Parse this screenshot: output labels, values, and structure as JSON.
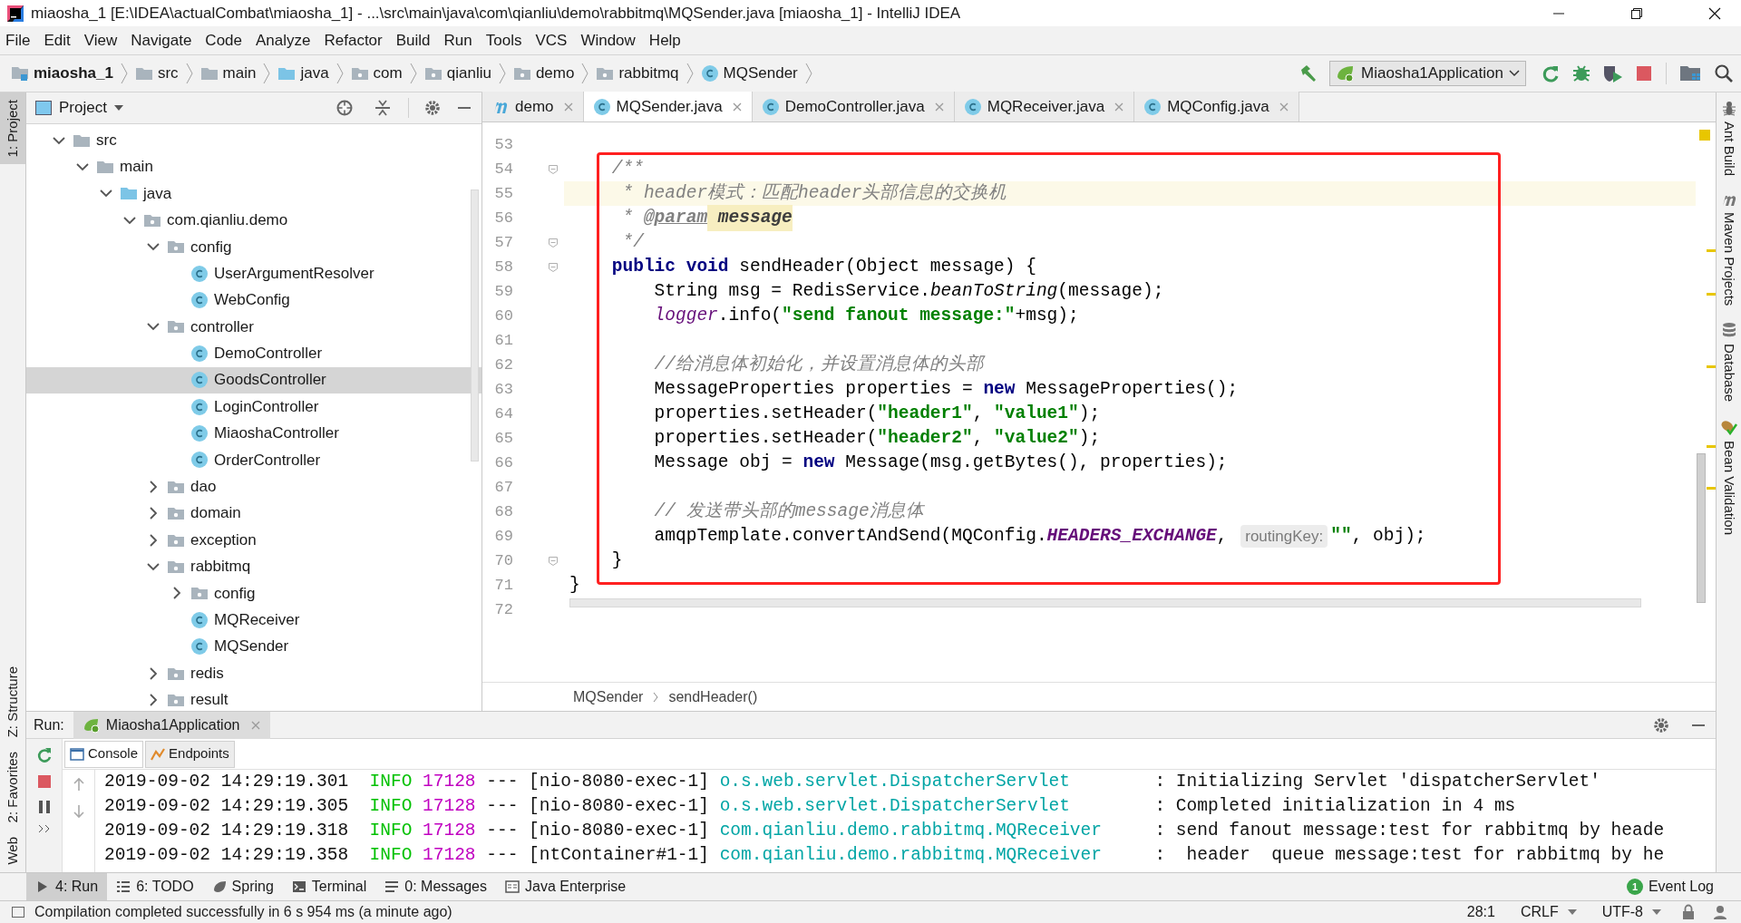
{
  "window": {
    "title": "miaosha_1 [E:\\IDEA\\actualCombat\\miaosha_1] - ...\\src\\main\\java\\com\\qianliu\\demo\\rabbitmq\\MQSender.java [miaosha_1] - IntelliJ IDEA"
  },
  "menu": [
    "File",
    "Edit",
    "View",
    "Navigate",
    "Code",
    "Analyze",
    "Refactor",
    "Build",
    "Run",
    "Tools",
    "VCS",
    "Window",
    "Help"
  ],
  "breadcrumbs": [
    {
      "label": "miaosha_1",
      "kind": "module"
    },
    {
      "label": "src",
      "kind": "folder"
    },
    {
      "label": "main",
      "kind": "folder"
    },
    {
      "label": "java",
      "kind": "source"
    },
    {
      "label": "com",
      "kind": "package"
    },
    {
      "label": "qianliu",
      "kind": "package"
    },
    {
      "label": "demo",
      "kind": "package"
    },
    {
      "label": "rabbitmq",
      "kind": "package"
    },
    {
      "label": "MQSender",
      "kind": "class"
    }
  ],
  "run_configuration": "Miaosha1Application",
  "left_strip": [
    {
      "label": "1: Project",
      "selected": true
    },
    {
      "label": "Z: Structure",
      "selected": false
    },
    {
      "label": "2: Favorites",
      "selected": false
    },
    {
      "label": "Web",
      "selected": false
    }
  ],
  "right_strip": [
    "Ant Build",
    "Maven Projects",
    "Database",
    "Bean Validation"
  ],
  "project": {
    "title": "Project",
    "tree": [
      {
        "label": "src",
        "kind": "folder",
        "expanded": true,
        "selected": false,
        "children": [
          {
            "label": "main",
            "kind": "folder",
            "expanded": true,
            "selected": false,
            "children": [
              {
                "label": "java",
                "kind": "source",
                "expanded": true,
                "selected": false,
                "children": [
                  {
                    "label": "com.qianliu.demo",
                    "kind": "package",
                    "expanded": true,
                    "selected": false,
                    "children": [
                      {
                        "label": "config",
                        "kind": "package",
                        "expanded": true,
                        "selected": false,
                        "children": [
                          {
                            "label": "UserArgumentResolver",
                            "kind": "class",
                            "selected": false
                          },
                          {
                            "label": "WebConfig",
                            "kind": "class",
                            "selected": false
                          }
                        ]
                      },
                      {
                        "label": "controller",
                        "kind": "package",
                        "expanded": true,
                        "selected": false,
                        "children": [
                          {
                            "label": "DemoController",
                            "kind": "class",
                            "selected": false
                          },
                          {
                            "label": "GoodsController",
                            "kind": "class",
                            "selected": true
                          },
                          {
                            "label": "LoginController",
                            "kind": "class",
                            "selected": false
                          },
                          {
                            "label": "MiaoshaController",
                            "kind": "class",
                            "selected": false
                          },
                          {
                            "label": "OrderController",
                            "kind": "class",
                            "selected": false
                          }
                        ]
                      },
                      {
                        "label": "dao",
                        "kind": "package",
                        "expanded": false,
                        "selected": false
                      },
                      {
                        "label": "domain",
                        "kind": "package",
                        "expanded": false,
                        "selected": false
                      },
                      {
                        "label": "exception",
                        "kind": "package",
                        "expanded": false,
                        "selected": false
                      },
                      {
                        "label": "rabbitmq",
                        "kind": "package",
                        "expanded": true,
                        "selected": false,
                        "children": [
                          {
                            "label": "config",
                            "kind": "package",
                            "expanded": false,
                            "selected": false
                          },
                          {
                            "label": "MQReceiver",
                            "kind": "class",
                            "selected": false
                          },
                          {
                            "label": "MQSender",
                            "kind": "class",
                            "selected": false
                          }
                        ]
                      },
                      {
                        "label": "redis",
                        "kind": "package",
                        "expanded": false,
                        "selected": false
                      },
                      {
                        "label": "result",
                        "kind": "package",
                        "expanded": false,
                        "selected": false
                      }
                    ]
                  }
                ]
              }
            ]
          }
        ]
      }
    ]
  },
  "editor": {
    "tabs": [
      {
        "label": "demo",
        "kind": "maven",
        "selected": false
      },
      {
        "label": "MQSender.java",
        "kind": "class",
        "selected": true
      },
      {
        "label": "DemoController.java",
        "kind": "class",
        "selected": false
      },
      {
        "label": "MQReceiver.java",
        "kind": "class",
        "selected": false
      },
      {
        "label": "MQConfig.java",
        "kind": "class",
        "selected": false
      }
    ],
    "lines": [
      {
        "number": "53",
        "current": false,
        "fold": false
      },
      {
        "number": "54",
        "current": false,
        "fold": true,
        "tokens": [
          {
            "text": "    /**",
            "kind": "doc"
          }
        ]
      },
      {
        "number": "55",
        "current": true,
        "fold": false,
        "tokens": [
          {
            "text": "     * header模式：匹配header头部信息的交换机",
            "kind": "doc"
          }
        ]
      },
      {
        "number": "56",
        "current": false,
        "fold": false,
        "tokens": [
          {
            "text": "     * ",
            "kind": "doc"
          },
          {
            "text": "@param",
            "kind": "doctag"
          },
          {
            "text": " message",
            "kind": "docparam"
          }
        ]
      },
      {
        "number": "57",
        "current": false,
        "fold": true,
        "tokens": [
          {
            "text": "     */",
            "kind": "doc"
          }
        ]
      },
      {
        "number": "58",
        "current": false,
        "fold": true,
        "tokens": [
          {
            "text": "    public void",
            "kind": "keyword"
          },
          {
            "text": " sendHeader(Object message) {",
            "kind": "plain"
          }
        ]
      },
      {
        "number": "59",
        "current": false,
        "fold": false,
        "tokens": [
          {
            "text": "        String msg = RedisService.",
            "kind": "plain"
          },
          {
            "text": "beanToString",
            "kind": "static"
          },
          {
            "text": "(message);",
            "kind": "plain"
          }
        ]
      },
      {
        "number": "60",
        "current": false,
        "fold": false,
        "tokens": [
          {
            "text": "        logger",
            "kind": "field"
          },
          {
            "text": ".info(",
            "kind": "plain"
          },
          {
            "text": "\"send fanout message:\"",
            "kind": "string"
          },
          {
            "text": "+msg);",
            "kind": "plain"
          }
        ]
      },
      {
        "number": "61",
        "current": false,
        "fold": false
      },
      {
        "number": "62",
        "current": false,
        "fold": false,
        "tokens": [
          {
            "text": "        //给消息体初始化，并设置消息体的头部",
            "kind": "comment"
          }
        ]
      },
      {
        "number": "63",
        "current": false,
        "fold": false,
        "tokens": [
          {
            "text": "        MessageProperties properties = ",
            "kind": "plain"
          },
          {
            "text": "new",
            "kind": "keyword"
          },
          {
            "text": " MessageProperties();",
            "kind": "plain"
          }
        ]
      },
      {
        "number": "64",
        "current": false,
        "fold": false,
        "tokens": [
          {
            "text": "        properties.setHeader(",
            "kind": "plain"
          },
          {
            "text": "\"header1\"",
            "kind": "string"
          },
          {
            "text": ", ",
            "kind": "plain"
          },
          {
            "text": "\"value1\"",
            "kind": "string"
          },
          {
            "text": ");",
            "kind": "plain"
          }
        ]
      },
      {
        "number": "65",
        "current": false,
        "fold": false,
        "tokens": [
          {
            "text": "        properties.setHeader(",
            "kind": "plain"
          },
          {
            "text": "\"header2\"",
            "kind": "string"
          },
          {
            "text": ", ",
            "kind": "plain"
          },
          {
            "text": "\"value2\"",
            "kind": "string"
          },
          {
            "text": ");",
            "kind": "plain"
          }
        ]
      },
      {
        "number": "66",
        "current": false,
        "fold": false,
        "tokens": [
          {
            "text": "        Message obj = ",
            "kind": "plain"
          },
          {
            "text": "new",
            "kind": "keyword"
          },
          {
            "text": " Message(msg.getBytes(), properties);",
            "kind": "plain"
          }
        ]
      },
      {
        "number": "67",
        "current": false,
        "fold": false
      },
      {
        "number": "68",
        "current": false,
        "fold": false,
        "tokens": [
          {
            "text": "        // 发送带头部的message消息体",
            "kind": "comment"
          }
        ]
      },
      {
        "number": "69",
        "current": false,
        "fold": false,
        "tokens": [
          {
            "text": "        amqpTemplate.convertAndSend(MQConfig.",
            "kind": "plain"
          },
          {
            "text": "HEADERS_EXCHANGE",
            "kind": "constant"
          },
          {
            "text": ", ",
            "kind": "plain"
          },
          {
            "text": "routingKey:",
            "kind": "inlay"
          },
          {
            "text": "\"\"",
            "kind": "string"
          },
          {
            "text": ", obj);",
            "kind": "plain"
          }
        ]
      },
      {
        "number": "70",
        "current": false,
        "fold": true,
        "tokens": [
          {
            "text": "    }",
            "kind": "plain"
          }
        ]
      },
      {
        "number": "71",
        "current": false,
        "fold": false,
        "tokens": [
          {
            "text": "}",
            "kind": "plain"
          }
        ]
      },
      {
        "number": "72",
        "current": false,
        "fold": false
      }
    ],
    "breadcrumbs": [
      "MQSender",
      "sendHeader()"
    ]
  },
  "run": {
    "label": "Run:",
    "tab": "Miaosha1Application",
    "tabs": [
      {
        "label": "Console",
        "selected": true
      },
      {
        "label": "Endpoints",
        "selected": false
      }
    ],
    "console": [
      {
        "time": "2019-09-02 14:29:19.301",
        "level": "INFO",
        "pid": "17128",
        "sep": "---",
        "thread": "[nio-8080-exec-1]",
        "logger": "o.s.web.servlet.DispatcherServlet",
        "message": ": Initializing Servlet 'dispatcherServlet'"
      },
      {
        "time": "2019-09-02 14:29:19.305",
        "level": "INFO",
        "pid": "17128",
        "sep": "---",
        "thread": "[nio-8080-exec-1]",
        "logger": "o.s.web.servlet.DispatcherServlet",
        "message": ": Completed initialization in 4 ms"
      },
      {
        "time": "2019-09-02 14:29:19.318",
        "level": "INFO",
        "pid": "17128",
        "sep": "---",
        "thread": "[nio-8080-exec-1]",
        "logger": "com.qianliu.demo.rabbitmq.MQReceiver",
        "message": ": send fanout message:test for rabbitmq by heade"
      },
      {
        "time": "2019-09-02 14:29:19.358",
        "level": "INFO",
        "pid": "17128",
        "sep": "---",
        "thread": "[ntContainer#1-1]",
        "logger": "com.qianliu.demo.rabbitmq.MQReceiver",
        "message": ":  header  queue message:test for rabbitmq by he"
      }
    ]
  },
  "tool_windows": [
    {
      "label": "4: Run",
      "kind": "run",
      "selected": true
    },
    {
      "label": "6: TODO",
      "kind": "todo",
      "selected": false
    },
    {
      "label": "Spring",
      "kind": "spring",
      "selected": false
    },
    {
      "label": "Terminal",
      "kind": "terminal",
      "selected": false
    },
    {
      "label": "0: Messages",
      "kind": "messages",
      "selected": false
    },
    {
      "label": "Java Enterprise",
      "kind": "javaee",
      "selected": false
    }
  ],
  "event_log": {
    "label": "Event Log",
    "count": "1"
  },
  "status_bar": {
    "message": "Compilation completed successfully in 6 s 954 ms (a minute ago)",
    "position": "28:1",
    "line_separator": "CRLF",
    "encoding": "UTF-8"
  }
}
